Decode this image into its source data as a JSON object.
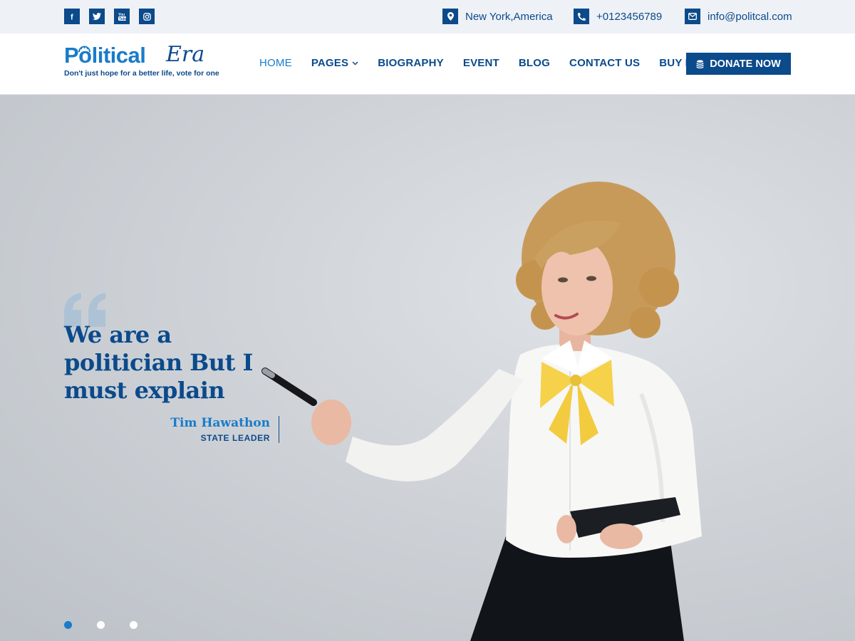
{
  "topbar": {
    "social": [
      {
        "name": "facebook-icon",
        "glyph": "f"
      },
      {
        "name": "twitter-icon",
        "glyph": "t"
      },
      {
        "name": "youtube-icon",
        "glyph": "yt"
      },
      {
        "name": "instagram-icon",
        "glyph": "ig"
      }
    ],
    "location": "New York,America",
    "phone": "+0123456789",
    "email": "info@politcal.com"
  },
  "header": {
    "logo_main": "Political",
    "logo_script": "Era",
    "logo_tagline": "Don't just hope for a better life, vote for one",
    "nav": [
      {
        "label": "HOME",
        "active": true
      },
      {
        "label": "PAGES",
        "active": false,
        "dropdown": true
      },
      {
        "label": "BIOGRAPHY",
        "active": false
      },
      {
        "label": "EVENT",
        "active": false
      },
      {
        "label": "BLOG",
        "active": false
      },
      {
        "label": "CONTACT US",
        "active": false
      },
      {
        "label": "BUY PRO",
        "active": false
      }
    ],
    "donate_label": "DONATE NOW"
  },
  "hero": {
    "headline": "We are a politician But I must explain",
    "author_name": "Tim Hawathon",
    "author_role": "STATE LEADER",
    "slides_total": 3,
    "slide_active": 1
  },
  "colors": {
    "primary": "#0b4a8b",
    "accent": "#1a7bc8",
    "topbar_bg": "#eef1f6"
  }
}
